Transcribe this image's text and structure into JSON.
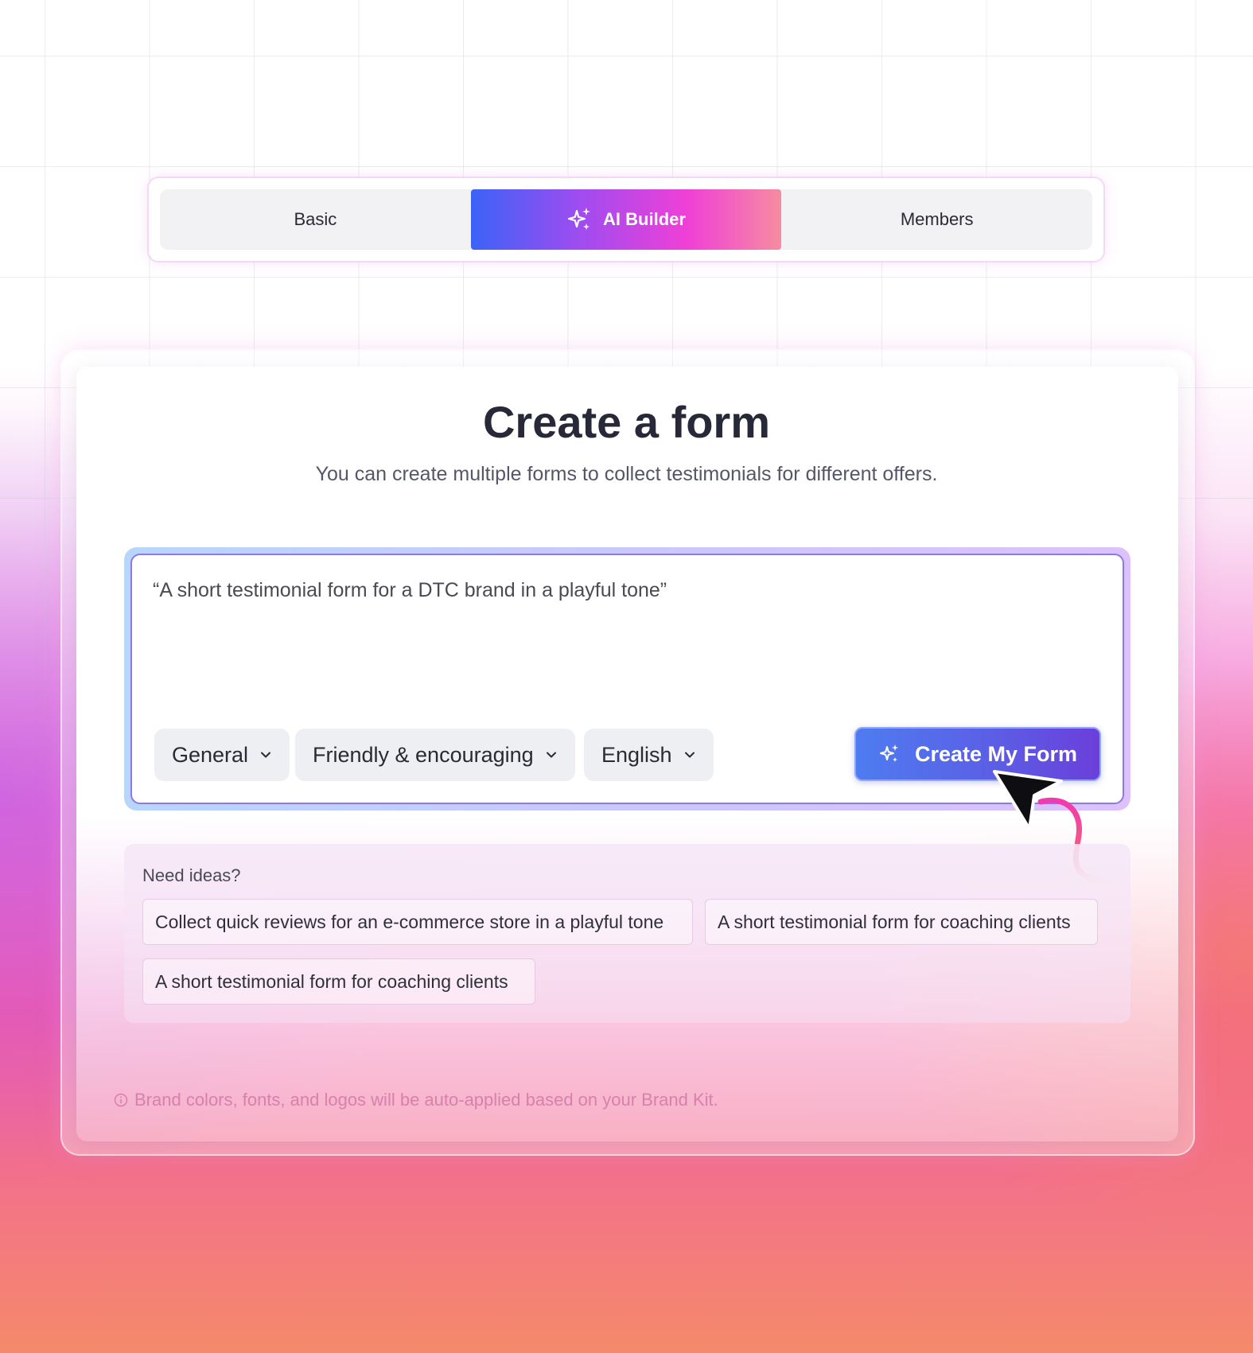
{
  "tabs": {
    "basic": "Basic",
    "ai_builder": "AI Builder",
    "members": "Members",
    "active": "ai_builder"
  },
  "card": {
    "title": "Create a form",
    "subtitle": "You can create multiple forms to collect testimonials for different offers."
  },
  "prompt": {
    "text": "“A short testimonial form for a DTC brand in a playful tone”"
  },
  "selectors": {
    "category": "General",
    "tone": "Friendly & encouraging",
    "language": "English"
  },
  "create_button": {
    "label": "Create My Form",
    "icon": "sparkle-icon"
  },
  "ideas": {
    "label": "Need ideas?",
    "items": [
      "Collect quick reviews for an e-commerce store in a playful tone",
      "A short testimonial form for coaching clients",
      "A short testimonial form for coaching clients"
    ]
  },
  "footnote": {
    "icon": "info-icon",
    "text": "Brand colors, fonts, and logos will be auto-applied based on your Brand Kit."
  },
  "colors": {
    "accent_blue": "#3b63f7",
    "accent_pink": "#f040d6",
    "button_purple": "#6b3fdb",
    "title_text": "#272838"
  }
}
